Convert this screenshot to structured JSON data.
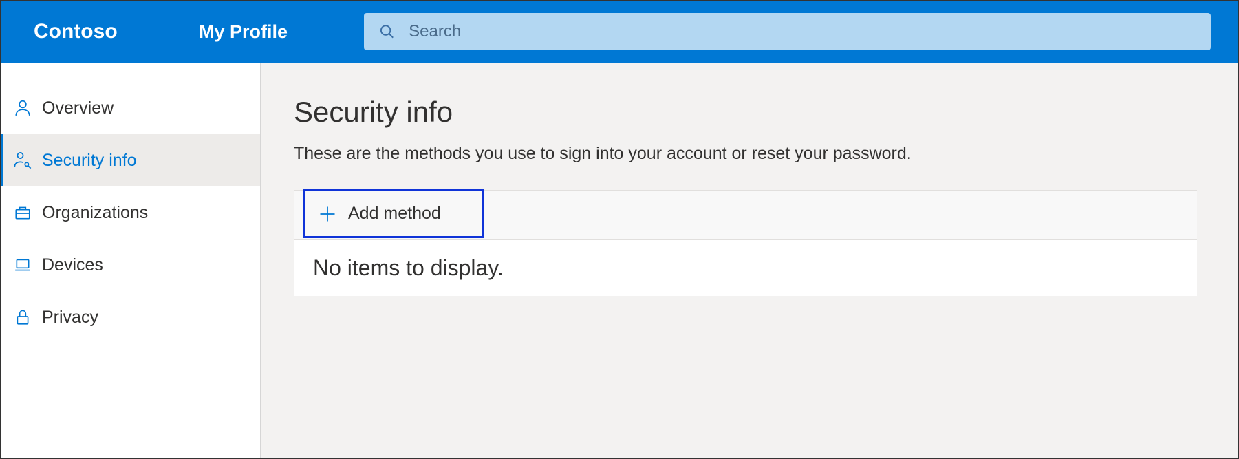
{
  "header": {
    "brand": "Contoso",
    "app_name": "My Profile",
    "search_placeholder": "Search"
  },
  "sidebar": {
    "items": [
      {
        "label": "Overview",
        "icon": "person"
      },
      {
        "label": "Security info",
        "icon": "person-key"
      },
      {
        "label": "Organizations",
        "icon": "briefcase"
      },
      {
        "label": "Devices",
        "icon": "laptop"
      },
      {
        "label": "Privacy",
        "icon": "lock"
      }
    ],
    "active_index": 1
  },
  "main": {
    "title": "Security info",
    "subtitle": "These are the methods you use to sign into your account or reset your password.",
    "add_button": "Add method",
    "empty_message": "No items to display."
  }
}
